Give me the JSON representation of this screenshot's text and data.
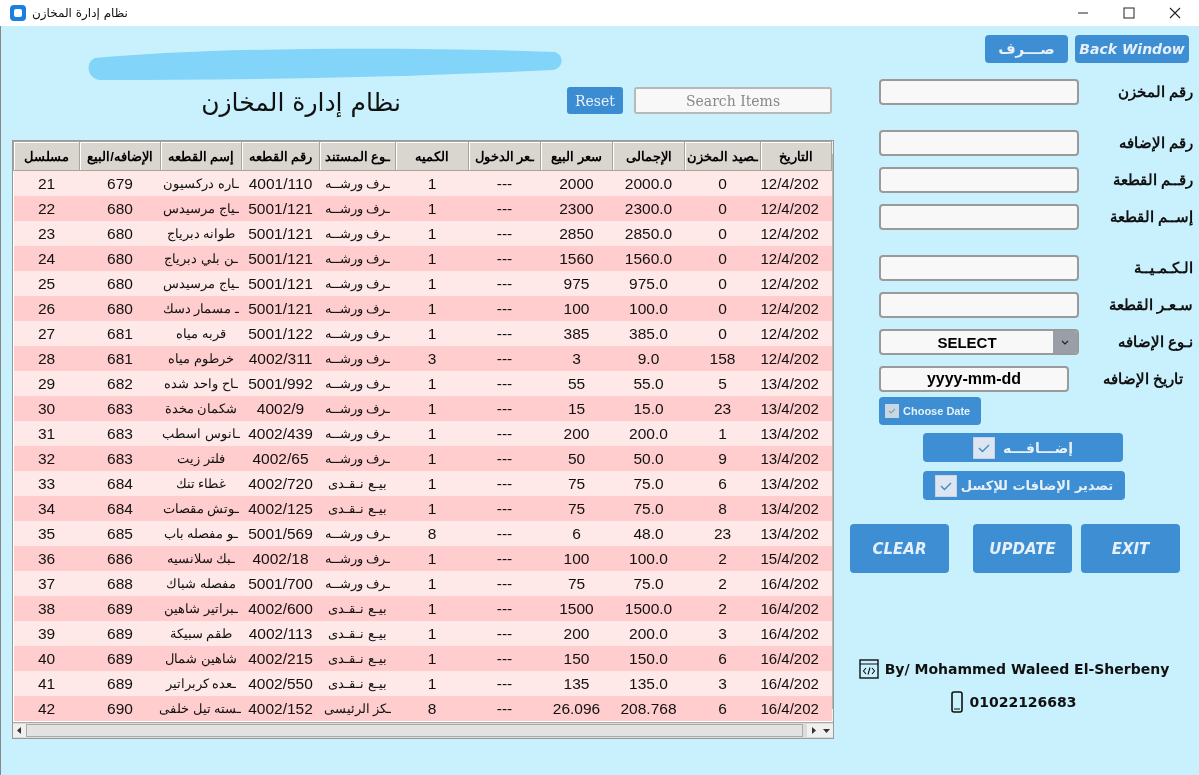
{
  "window": {
    "title": "نظام إدارة المخازن"
  },
  "header": {
    "subtitle": "نظام إدارة المخازن",
    "reset_button": "Reset",
    "search": {
      "placeholder": "Search Items"
    }
  },
  "table": {
    "columns": [
      "التاريخ",
      "ـصيد المخزن",
      "الإجمالى",
      "سعر البيع",
      "ـعر الدخول",
      "الكميه",
      "ـوع المستند",
      "رقم القطعه",
      "إسم القطعه",
      "الإضافه/البيع",
      "مسلسل"
    ],
    "rows": [
      [
        "12/4/202",
        "0",
        "2000.0",
        "2000",
        "---",
        "1",
        "ـرف ورشــه",
        "4001/110",
        "ـاره دركسيون",
        "679",
        "21"
      ],
      [
        "12/4/202",
        "0",
        "2300.0",
        "2300",
        "---",
        "1",
        "ـرف ورشــه",
        "5001/121",
        "ـياج مرسيدس",
        "680",
        "22"
      ],
      [
        "12/4/202",
        "0",
        "2850.0",
        "2850",
        "---",
        "1",
        "ـرف ورشــه",
        "5001/121",
        "طوانه دبرياج",
        "680",
        "23"
      ],
      [
        "12/4/202",
        "0",
        "1560.0",
        "1560",
        "---",
        "1",
        "ـرف ورشــه",
        "5001/121",
        "ـن بلي دبرياج",
        "680",
        "24"
      ],
      [
        "12/4/202",
        "0",
        "975.0",
        "975",
        "---",
        "1",
        "ـرف ورشــه",
        "5001/121",
        "ـياج مرسيدس",
        "680",
        "25"
      ],
      [
        "12/4/202",
        "0",
        "100.0",
        "100",
        "---",
        "1",
        "ـرف ورشــه",
        "5001/121",
        "ـ مسمار دسك",
        "680",
        "26"
      ],
      [
        "12/4/202",
        "0",
        "385.0",
        "385",
        "---",
        "1",
        "ـرف ورشــه",
        "5001/122",
        "قربه مياه",
        "681",
        "27"
      ],
      [
        "12/4/202",
        "158",
        "9.0",
        "3",
        "---",
        "3",
        "ـرف ورشــه",
        "4002/311",
        "خرطوم مياه",
        "681",
        "28"
      ],
      [
        "13/4/202",
        "5",
        "55.0",
        "55",
        "---",
        "1",
        "ـرف ورشــه",
        "5001/992",
        "ـاح واحد شده",
        "682",
        "29"
      ],
      [
        "13/4/202",
        "23",
        "15.0",
        "15",
        "---",
        "1",
        "ـرف ورشــه",
        "4002/9",
        "شكمان مخدة",
        "683",
        "30"
      ],
      [
        "13/4/202",
        "1",
        "200.0",
        "200",
        "---",
        "1",
        "ـرف ورشــه",
        "4002/439",
        "ـانوس اسطب",
        "683",
        "31"
      ],
      [
        "13/4/202",
        "9",
        "50.0",
        "50",
        "---",
        "1",
        "ـرف ورشــه",
        "4002/65",
        "فلتر زيت",
        "683",
        "32"
      ],
      [
        "13/4/202",
        "6",
        "75.0",
        "75",
        "---",
        "1",
        "بيـع نـقـدى",
        "4002/720",
        "غطاء تنك",
        "684",
        "33"
      ],
      [
        "13/4/202",
        "8",
        "75.0",
        "75",
        "---",
        "1",
        "بيـع نـقـدى",
        "4002/125",
        "ـوتش مقصات",
        "684",
        "34"
      ],
      [
        "13/4/202",
        "23",
        "48.0",
        "6",
        "---",
        "8",
        "ـرف ورشــه",
        "5001/569",
        "ـو مفصله باب",
        "685",
        "35"
      ],
      [
        "15/4/202",
        "2",
        "100.0",
        "100",
        "---",
        "1",
        "ـرف ورشــه",
        "4002/18",
        "ـبك سلانسيه",
        "686",
        "36"
      ],
      [
        "16/4/202",
        "2",
        "75.0",
        "75",
        "---",
        "1",
        "ـرف ورشــه",
        "5001/700",
        "مفصله شباك",
        "688",
        "37"
      ],
      [
        "16/4/202",
        "2",
        "1500.0",
        "1500",
        "---",
        "1",
        "بيـع نـقـدى",
        "4002/600",
        "ـبراتير شاهين",
        "689",
        "38"
      ],
      [
        "16/4/202",
        "3",
        "200.0",
        "200",
        "---",
        "1",
        "بيـع نـقـدى",
        "4002/113",
        "طقم سبيكة",
        "689",
        "39"
      ],
      [
        "16/4/202",
        "6",
        "150.0",
        "150",
        "---",
        "1",
        "بيـع نـقـدى",
        "4002/215",
        "شاهين شمال",
        "689",
        "40"
      ],
      [
        "16/4/202",
        "3",
        "135.0",
        "135",
        "---",
        "1",
        "بيـع نـقـدى",
        "4002/550",
        "ـعده كربراتير",
        "689",
        "41"
      ],
      [
        "16/4/202",
        "6",
        "208.768",
        "26.096",
        "---",
        "8",
        "ـكز الرئيسى",
        "4002/152",
        "ـسته تيل خلفى",
        "690",
        "42"
      ]
    ]
  },
  "top_buttons": [
    "Back Window",
    "صـــرف"
  ],
  "form": [
    {
      "kind": "text",
      "label": "رقم المخزن"
    },
    {
      "kind": "text",
      "label": "رقم الإضافه"
    },
    {
      "kind": "text",
      "label": "رقــم القطعة"
    },
    {
      "kind": "text",
      "label": "إســم القطعة"
    },
    {
      "kind": "text",
      "label": "الـكـمـيــة"
    },
    {
      "kind": "text",
      "label": "سـعـر القطعة"
    },
    {
      "kind": "select",
      "label": "نـوع الإضافه",
      "value": "SELECT"
    },
    {
      "kind": "date",
      "label": "تاريخ الإضافه",
      "value": "yyyy-mm-dd"
    }
  ],
  "choose_date": {
    "label": "Choose Date",
    "checked": true
  },
  "check_buttons": [
    {
      "label": "إضـــافـــه",
      "checked": true
    },
    {
      "label": "تصدير الإضافات للإكسل",
      "checked": true
    }
  ],
  "action_buttons": [
    "EXIT",
    "UPDATE",
    "CLEAR"
  ],
  "credits": {
    "author": "By/ Mohammed Waleed El-Sherbeny",
    "phone": "01022126683"
  }
}
